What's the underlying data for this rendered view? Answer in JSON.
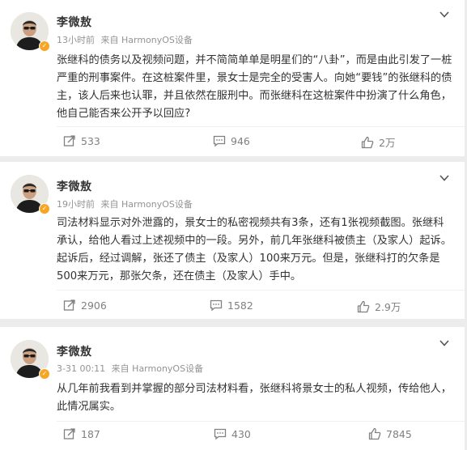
{
  "posts": [
    {
      "author": "李微敖",
      "time": "13小时前",
      "source": "来自 HarmonyOS设备",
      "text": "张继科的债务以及视频问题，并不简简单单是明星们的“八卦”，而是由此引发了一桩严重的刑事案件。在这桩案件里，景女士是完全的受害人。向她“要钱”的张继科的债主，该人后来也认罪，并且依然在服刑中。而张继科在这桩案件中扮演了什么角色，他自己能否来公开予以回应?",
      "repost": "533",
      "comment": "946",
      "like": "2万"
    },
    {
      "author": "李微敖",
      "time": "19小时前",
      "source": "来自 HarmonyOS设备",
      "text": "司法材料显示对外泄露的，景女士的私密视频共有3条，还有1张视频截图。张继科承认，给他人看过上述视频中的一段。另外，前几年张继科被债主（及家人）起诉。起诉后，经过调解，张还了债主（及家人）100来万元。但是，张继科打的欠条是500来万元，那张欠条，还在债主（及家人）手中。",
      "repost": "2906",
      "comment": "1582",
      "like": "2.9万"
    },
    {
      "author": "李微敖",
      "time": "3-31 00:11",
      "source": "来自 HarmonyOS设备",
      "text": "从几年前我看到并掌握的部分司法材料看，张继科将景女士的私人视频，传给他人，此情况属实。",
      "repost": "187",
      "comment": "430",
      "like": "7845"
    }
  ],
  "icons": {
    "repost": "repost-icon",
    "comment": "comment-icon",
    "like": "like-icon",
    "menu": "chevron-down-icon",
    "verified": "verified-badge-icon"
  },
  "colors": {
    "background": "#ececec",
    "card": "#ffffff",
    "text": "#333333",
    "meta": "#939393",
    "action": "#808080",
    "badge": "#f6a623"
  }
}
